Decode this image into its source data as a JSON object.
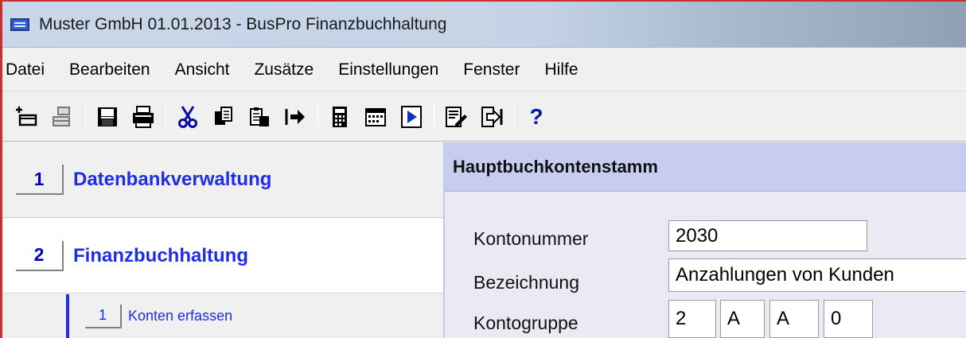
{
  "window": {
    "title": "Muster GmbH 01.01.2013 - BusPro Finanzbuchhaltung",
    "app_icon": "window-app-icon"
  },
  "menu": [
    "Datei",
    "Bearbeiten",
    "Ansicht",
    "Zusätze",
    "Einstellungen",
    "Fenster",
    "Hilfe"
  ],
  "toolbar": {
    "buttons": [
      "new-icon",
      "tree-icon",
      "save-icon",
      "print-icon",
      "cut-icon",
      "copy-icon",
      "paste-icon",
      "export-icon",
      "calculator-icon",
      "calendar-icon",
      "play-icon",
      "edit-icon",
      "exit-icon",
      "help-icon"
    ],
    "help_label": "?"
  },
  "nav": {
    "items": [
      {
        "number": "1",
        "label": "Datenbankverwaltung"
      },
      {
        "number": "2",
        "label": "Finanzbuchhaltung"
      }
    ],
    "sub_item": {
      "number": "1",
      "label": "Konten erfassen"
    }
  },
  "content": {
    "title": "Hauptbuchkontenstamm",
    "fields": {
      "kontonummer_label": "Kontonummer",
      "kontonummer_value": "2030",
      "bezeichnung_label": "Bezeichnung",
      "bezeichnung_value": "Anzahlungen von Kunden",
      "kontogruppe_label": "Kontogruppe",
      "kontogruppe_values": [
        "2",
        "A",
        "A",
        "0"
      ]
    }
  },
  "colors": {
    "accent": "#1f2de6",
    "header_bg": "#c7cdf0",
    "frame": "#c8302e"
  }
}
